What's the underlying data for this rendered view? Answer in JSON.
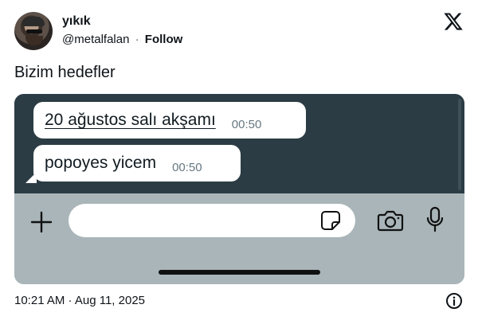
{
  "tweet": {
    "display_name": "yıkık",
    "handle": "@metalfalan",
    "separator": "·",
    "follow_label": "Follow",
    "text": "Bizim hedefler",
    "timestamp": "10:21 AM · Aug 11, 2025"
  },
  "screenshot": {
    "messages": [
      {
        "text": "20 ağustos salı akşamı",
        "time": "00:50"
      },
      {
        "text": "popoyes yicem",
        "time": "00:50"
      }
    ],
    "input_placeholder": ""
  },
  "icons": {
    "logo": "x-logo-icon",
    "info": "info-icon",
    "plus": "plus-icon",
    "sticker": "sticker-icon",
    "camera": "camera-icon",
    "mic": "mic-icon"
  },
  "colors": {
    "chat_background": "#2b3c44",
    "input_bar_background": "#a9b5b9",
    "bubble": "#ffffff",
    "text_primary": "#0f1419"
  }
}
